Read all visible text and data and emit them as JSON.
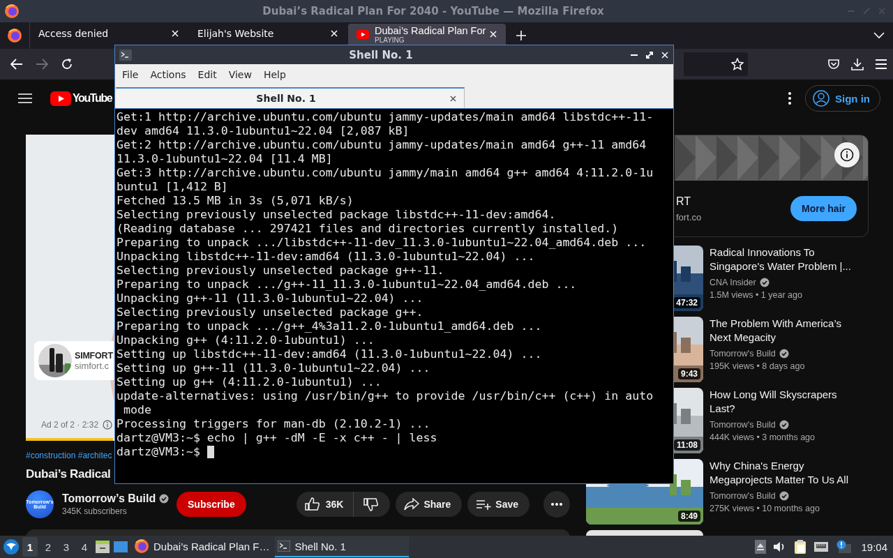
{
  "browser": {
    "title": "Dubai’s Radical Plan For 2040 - YouTube — Mozilla Firefox",
    "tabs": [
      {
        "kind": "page",
        "label": "Access denied",
        "selected": false
      },
      {
        "kind": "page",
        "label": "Elijah's Website",
        "selected": false
      },
      {
        "kind": "video",
        "label": "Dubai’s Radical Plan For",
        "status": "PLAYING",
        "selected": true
      }
    ],
    "nav_buttons": [
      {
        "kind": "back",
        "disabled": false
      },
      {
        "kind": "forward",
        "disabled": true
      },
      {
        "kind": "reload",
        "disabled": false
      }
    ]
  },
  "youtube": {
    "logo": "YouTube",
    "sign_in": "Sign in",
    "player": {
      "ad_name": "SIMFORT",
      "ad_url": "simfort.c",
      "ad_info": "Ad 2 of 2 · 2:32",
      "ad_progress": {
        "level": 0.16
      }
    },
    "hashtags": "#construction #architec",
    "title": "Dubai’s Radical",
    "channel": {
      "avatar_text": "Tomorrow's Build",
      "name": "Tomorrow’s Build",
      "verified": true,
      "subscribers": "345K subscribers"
    },
    "subscribe": "Subscribe",
    "likes": "36K",
    "share": "Share",
    "save": "Save",
    "side_ad": {
      "name": "RT",
      "url": "fort.co",
      "button": "More hair"
    },
    "videos": [
      {
        "title": "Radical Innovations To Singapore's Water Problem |...",
        "channel": "CNA Insider",
        "verified": true,
        "views": "1.5M views",
        "age": "• 1 year ago",
        "duration": "47:32"
      },
      {
        "title": "The Problem With America’s Next Megacity",
        "channel": "Tomorrow's Build",
        "verified": true,
        "views": "195K views",
        "age": "• 8 days ago",
        "duration": "9:43"
      },
      {
        "title": "How Long Will Skyscrapers Last?",
        "channel": "Tomorrow's Build",
        "verified": true,
        "views": "444K views",
        "age": "• 3 months ago",
        "duration": "11:08"
      },
      {
        "title": "Why China's Energy Megaprojects Matter To Us All",
        "channel": "Tomorrow's Build",
        "verified": true,
        "views": "275K views",
        "age": "• 10 months ago",
        "duration": "8:49"
      }
    ]
  },
  "terminal": {
    "title": "Shell No. 1",
    "menu": [
      "File",
      "Actions",
      "Edit",
      "View",
      "Help"
    ],
    "tabs": [
      {
        "label": "Shell No. 1",
        "selected": true
      }
    ],
    "lines": [
      "Get:1 http://archive.ubuntu.com/ubuntu jammy-updates/main amd64 libstdc++-11-",
      "dev amd64 11.3.0-1ubuntu1~22.04 [2,087 kB]",
      "Get:2 http://archive.ubuntu.com/ubuntu jammy-updates/main amd64 g++-11 amd64",
      "11.3.0-1ubuntu1~22.04 [11.4 MB]",
      "Get:3 http://archive.ubuntu.com/ubuntu jammy/main amd64 g++ amd64 4:11.2.0-1u",
      "buntu1 [1,412 B]",
      "Fetched 13.5 MB in 3s (5,071 kB/s)",
      "Selecting previously unselected package libstdc++-11-dev:amd64.",
      "(Reading database ... 297421 files and directories currently installed.)",
      "Preparing to unpack .../libstdc++-11-dev_11.3.0-1ubuntu1~22.04_amd64.deb ...",
      "Unpacking libstdc++-11-dev:amd64 (11.3.0-1ubuntu1~22.04) ...",
      "Selecting previously unselected package g++-11.",
      "Preparing to unpack .../g++-11_11.3.0-1ubuntu1~22.04_amd64.deb ...",
      "Unpacking g++-11 (11.3.0-1ubuntu1~22.04) ...",
      "Selecting previously unselected package g++.",
      "Preparing to unpack .../g++_4%3a11.2.0-1ubuntu1_amd64.deb ...",
      "Unpacking g++ (4:11.2.0-1ubuntu1) ...",
      "Setting up libstdc++-11-dev:amd64 (11.3.0-1ubuntu1~22.04) ...",
      "Setting up g++-11 (11.3.0-1ubuntu1~22.04) ...",
      "Setting up g++ (4:11.2.0-1ubuntu1) ...",
      "update-alternatives: using /usr/bin/g++ to provide /usr/bin/c++ (c++) in auto",
      " mode",
      "Processing triggers for man-db (2.10.2-1) ...",
      "dartz@VM3:~$ echo | g++ -dM -E -x c++ - | less",
      "dartz@VM3:~$"
    ]
  },
  "taskbar": {
    "workspaces": [
      {
        "label": "1",
        "selected": true
      },
      {
        "label": "2",
        "selected": false
      },
      {
        "label": "3",
        "selected": false
      },
      {
        "label": "4",
        "selected": false
      }
    ],
    "tasks": [
      {
        "kind": "browser",
        "label": "Dubai’s Radical Plan F…",
        "selected": false
      },
      {
        "kind": "terminal",
        "label": "Shell No. 1",
        "selected": true
      }
    ],
    "clock": "19:04"
  }
}
